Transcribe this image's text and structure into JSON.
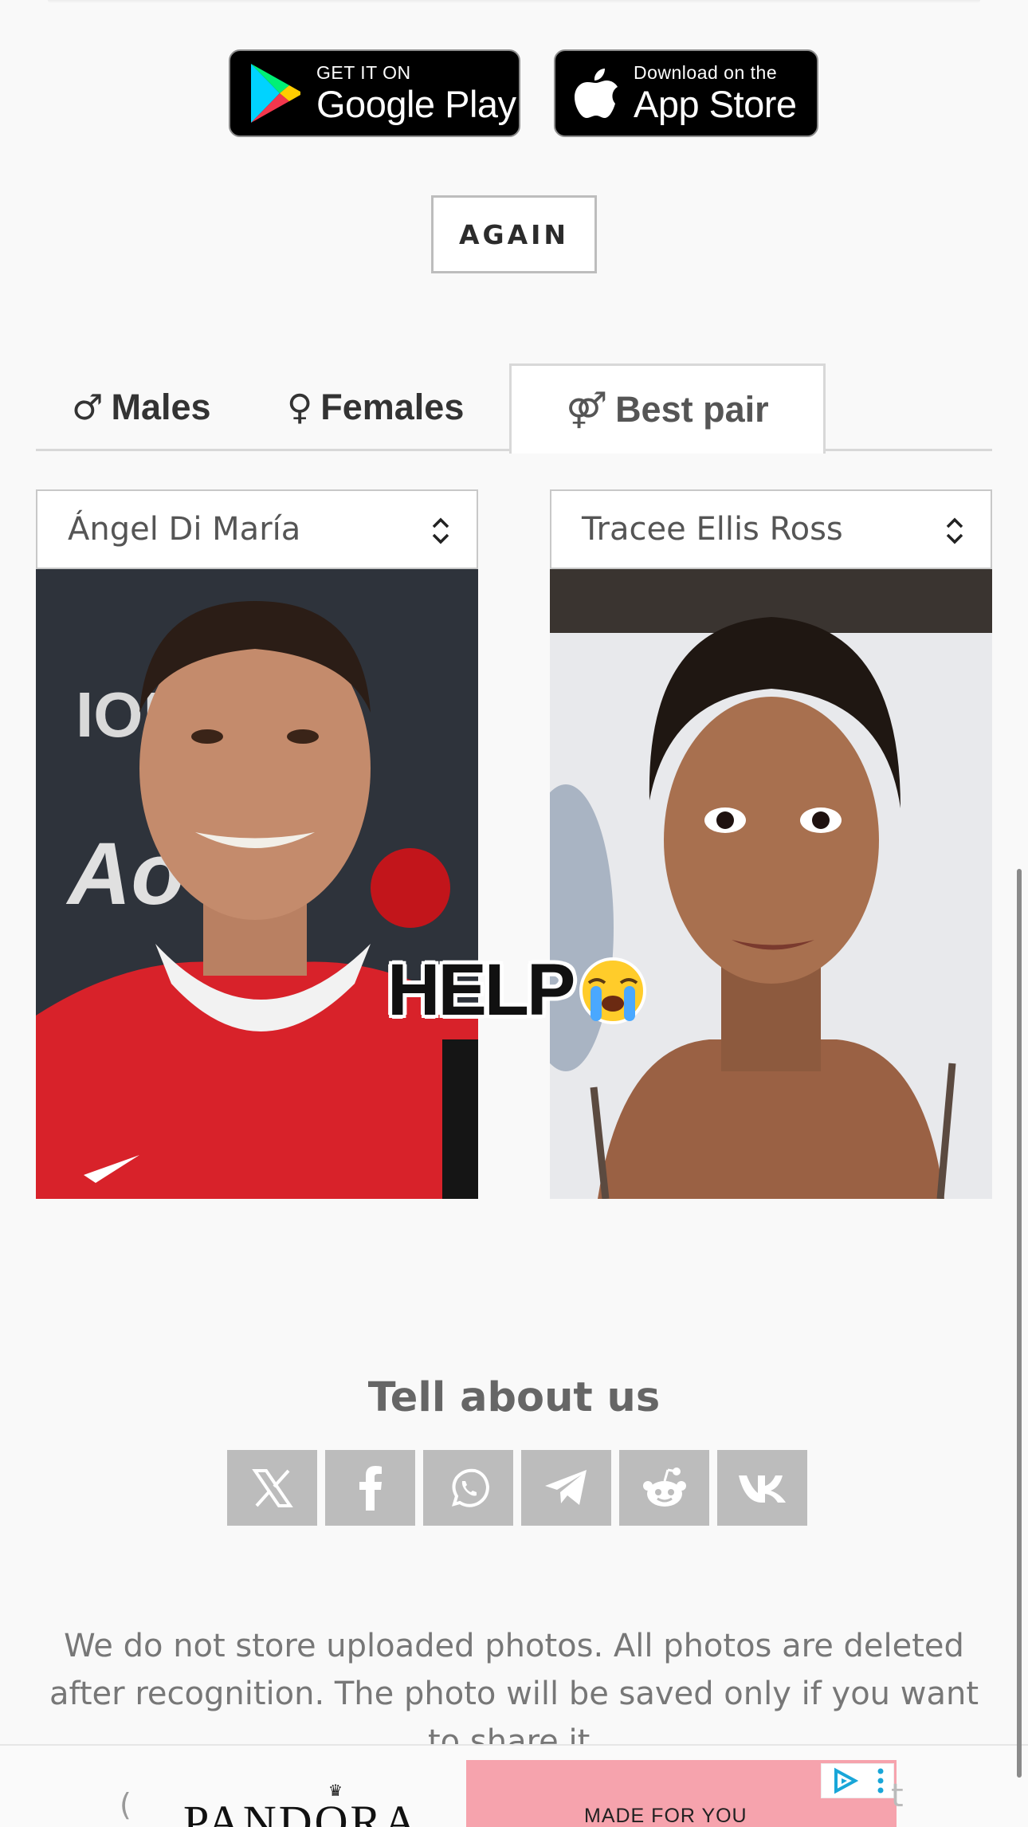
{
  "store_buttons": {
    "google_play": {
      "small": "GET IT ON",
      "big": "Google Play"
    },
    "app_store": {
      "small": "Download on the",
      "big": "App Store"
    }
  },
  "again_button": "AGAIN",
  "tabs": [
    {
      "symbol": "♂",
      "label": "Males"
    },
    {
      "symbol": "♀",
      "label": "Females"
    },
    {
      "symbol": "⚤",
      "label": "Best pair"
    }
  ],
  "selects": {
    "left": "Ángel Di María",
    "right": "Tracee Ellis Ross"
  },
  "overlay_text": "HELP",
  "overlay_emoji": "😭",
  "share": {
    "title": "Tell about us",
    "buttons": [
      "x-icon",
      "facebook-icon",
      "whatsapp-icon",
      "telegram-icon",
      "reddit-icon",
      "vk-icon"
    ]
  },
  "notice": "We do not store uploaded photos. All photos are deleted after recognition. The photo will be saved only if you want to share it.",
  "ad": {
    "paren": "(",
    "brand": "PANDORA",
    "tagline": "MADE FOR YOU",
    "trailing": "t"
  },
  "colors": {
    "background": "#f9f9f9",
    "share_button": "#bcbcbc",
    "ad_pink": "#f6a3ad"
  }
}
